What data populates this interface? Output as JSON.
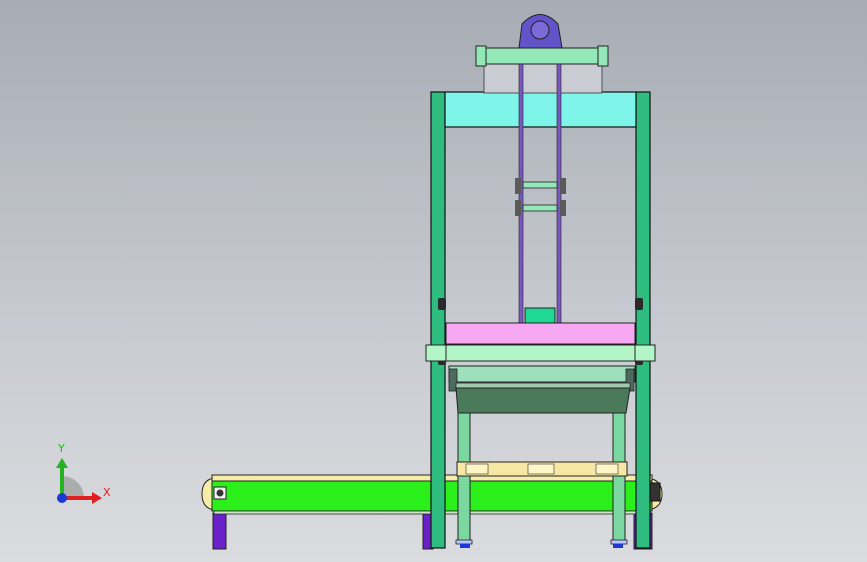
{
  "viewport": {
    "background_top": "#a7acb4",
    "background_bottom": "#dadcdf"
  },
  "triad": {
    "x_label": "X",
    "y_label": "Y",
    "x_color": "#e02020",
    "y_color": "#22b222",
    "origin_color": "#1a3ad8"
  },
  "model": {
    "frame_color": "#2ebd7f",
    "top_beam_color": "#7ff5ea",
    "platform_color": "#f7a8f3",
    "conveyor_color": "#2bef1b",
    "bearing_color": "#6254c8",
    "gear_color": "#7b57c2",
    "hopper_color": "#4b7a5b",
    "leg_color": "#7ad8a0",
    "pallet_color": "#f6e7a4",
    "foot_color": "#6a22c8"
  }
}
